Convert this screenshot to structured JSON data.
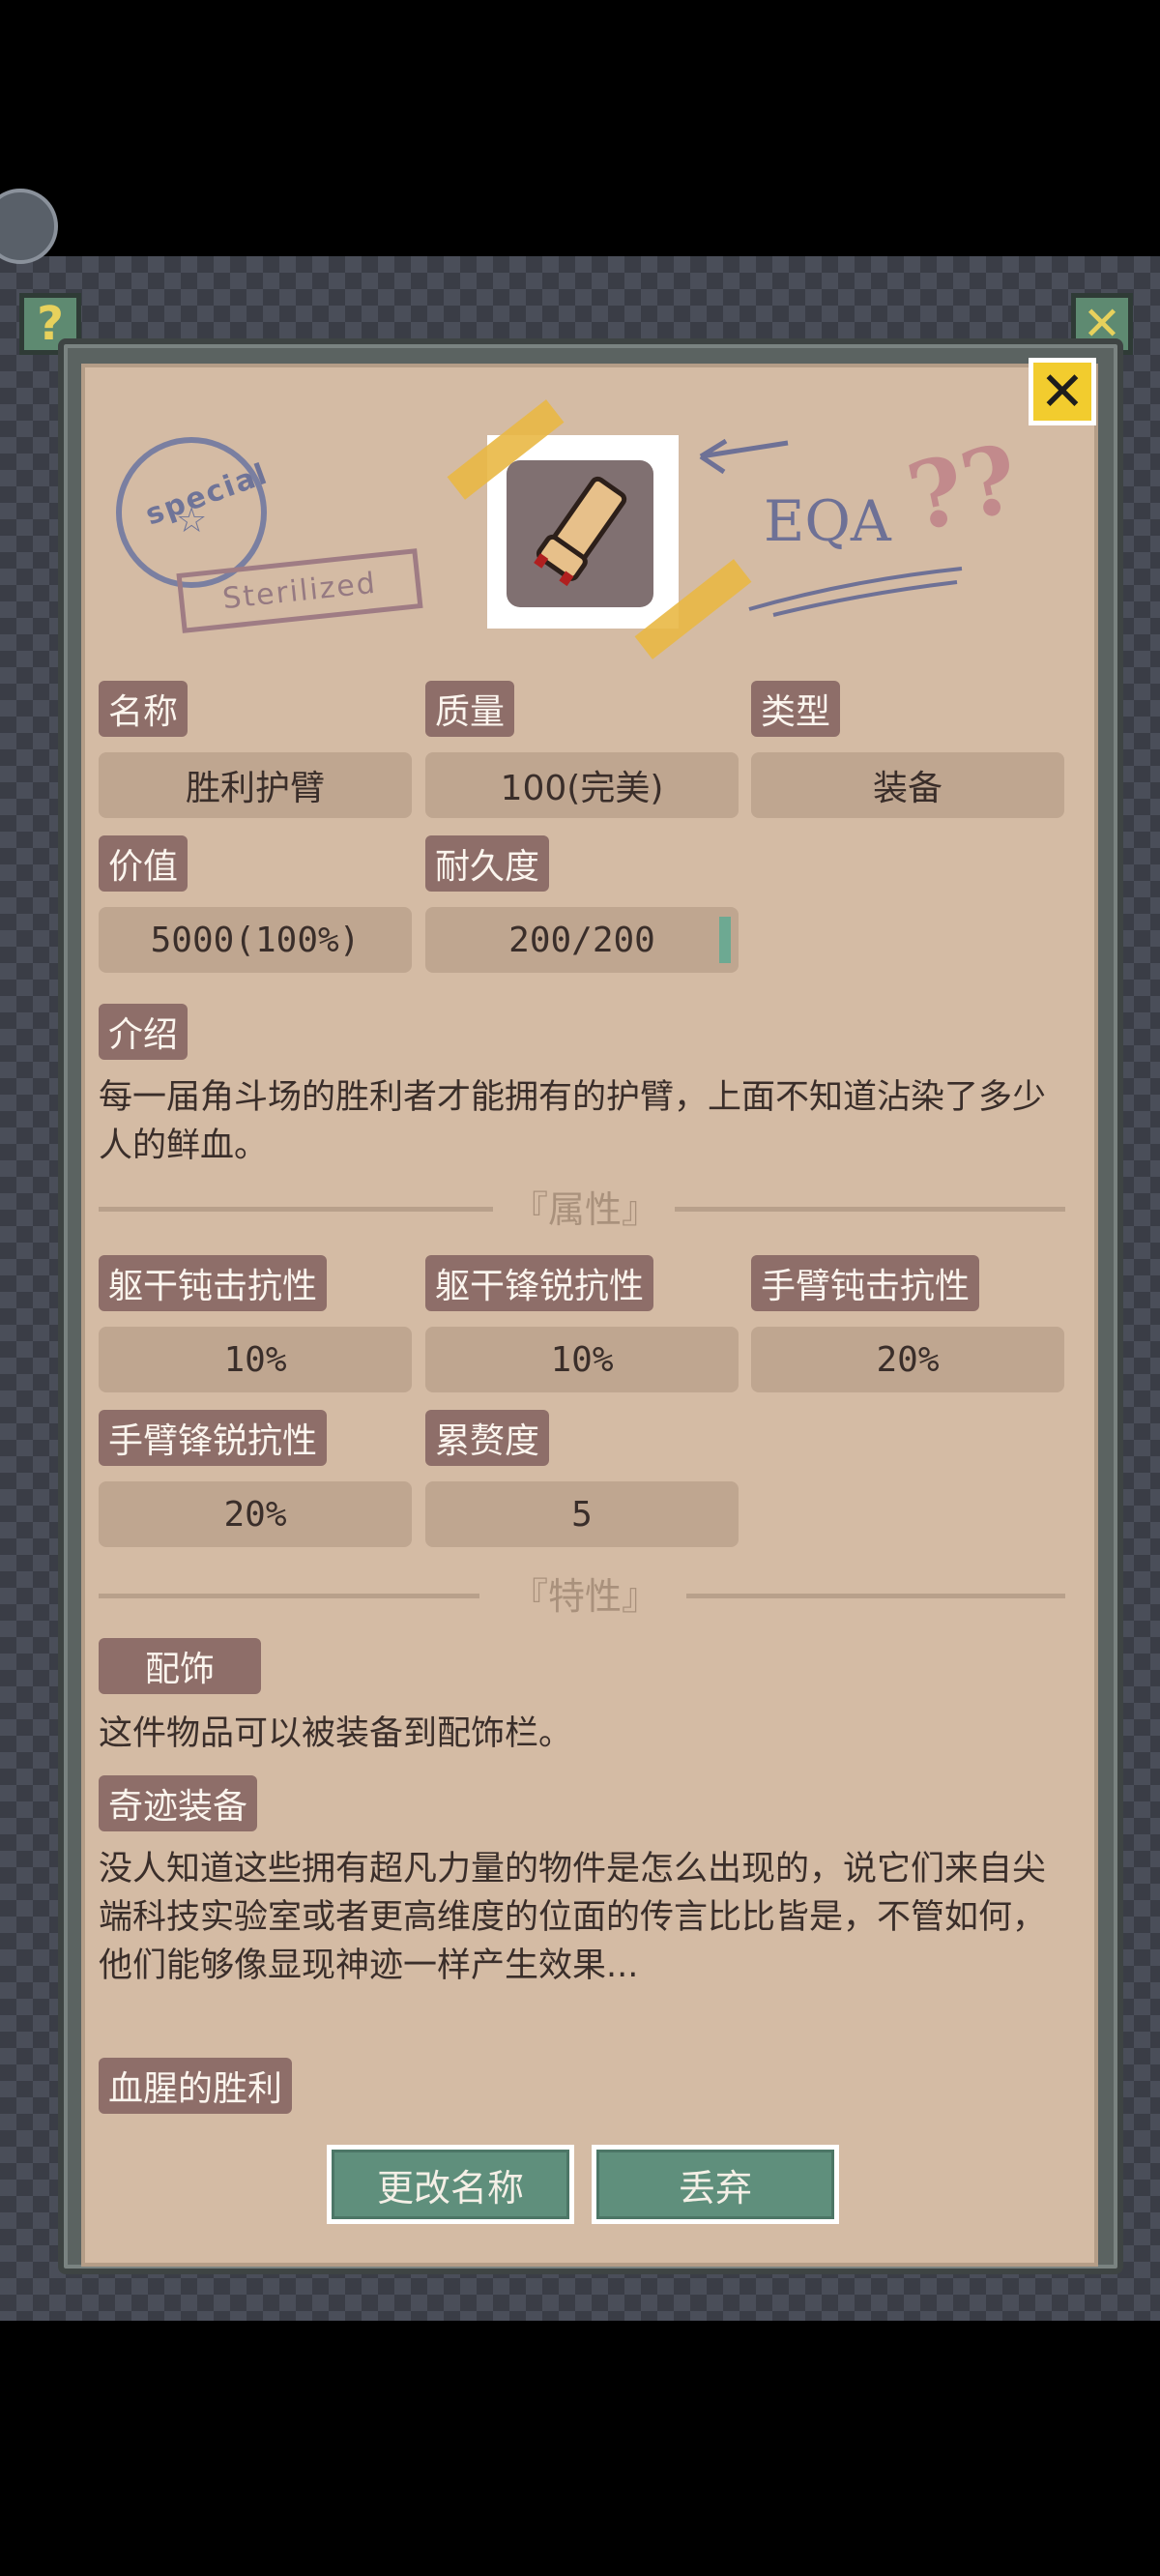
{
  "header": {
    "help_icon": "question-mark",
    "close_icon": "x-mark",
    "help_glyph": "?",
    "close_glyph": "✕"
  },
  "decor": {
    "stamp_circle_text": "special",
    "stamp_circle_symbol": "☆",
    "stamp_rect_text": "Sterilized",
    "eqa_text": "EQA",
    "question_marks": "??"
  },
  "fields": {
    "name_label": "名称",
    "name_value": "胜利护臂",
    "quality_label": "质量",
    "quality_value": "100(完美)",
    "type_label": "类型",
    "type_value": "装备",
    "price_label": "价值",
    "price_value": "5000(100%)",
    "durability_label": "耐久度",
    "durability_value": "200/200",
    "durability_fraction": 1.0
  },
  "intro": {
    "label": "介绍",
    "text": "每一届角斗场的胜利者才能拥有的护臂，上面不知道沾染了多少人的鲜血。"
  },
  "attributes": {
    "section_title": "『属性』",
    "items": [
      {
        "label": "躯干钝击抗性",
        "value": "10%"
      },
      {
        "label": "躯干锋锐抗性",
        "value": "10%"
      },
      {
        "label": "手臂钝击抗性",
        "value": "20%"
      },
      {
        "label": "手臂锋锐抗性",
        "value": "20%"
      },
      {
        "label": "累赘度",
        "value": "5"
      }
    ]
  },
  "traits": {
    "section_title": "『特性』",
    "items": [
      {
        "label": "配饰",
        "text": "这件物品可以被装备到配饰栏。"
      },
      {
        "label": "奇迹装备",
        "text": "没人知道这些拥有超凡力量的物件是怎么出现的，说它们来自尖端科技实验室或者更高维度的位面的传言比比皆是，不管如何，他们能够像显现神迹一样产生效果..."
      },
      {
        "label": "血腥的胜利",
        "text": ""
      }
    ]
  },
  "buttons": {
    "rename": "更改名称",
    "discard": "丢弃"
  },
  "colors": {
    "paper": "#d4bba4",
    "tag": "#8e6e69",
    "value_box": "#bfa690",
    "button": "#5f8f7c",
    "close": "#f2cc2e"
  }
}
